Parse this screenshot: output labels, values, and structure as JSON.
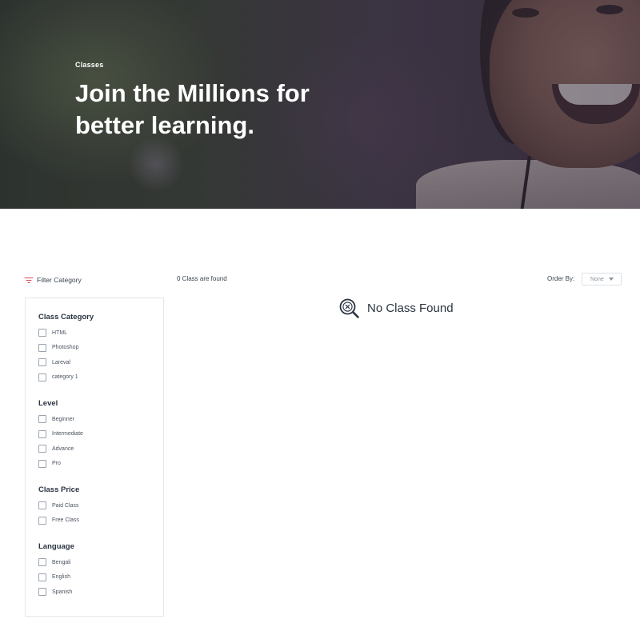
{
  "hero": {
    "breadcrumb": "Classes",
    "title": "Join the Millions for better learning."
  },
  "filters": {
    "header_label": "Filter Category",
    "groups": [
      {
        "title": "Class Category",
        "options": [
          "HTML",
          "Photoshop",
          "Lareval",
          "category 1"
        ]
      },
      {
        "title": "Level",
        "options": [
          "Beginner",
          "Intermediate",
          "Advance",
          "Pro"
        ]
      },
      {
        "title": "Class Price",
        "options": [
          "Paid Class",
          "Free Class"
        ]
      },
      {
        "title": "Language",
        "options": [
          "Bengali",
          "English",
          "Spanish"
        ]
      }
    ]
  },
  "results": {
    "count_text": "0 Class are found",
    "order_label": "Order By:",
    "order_value": "None",
    "empty_message": "No Class Found"
  },
  "colors": {
    "accent": "#e3465b",
    "text": "#2a3340"
  }
}
